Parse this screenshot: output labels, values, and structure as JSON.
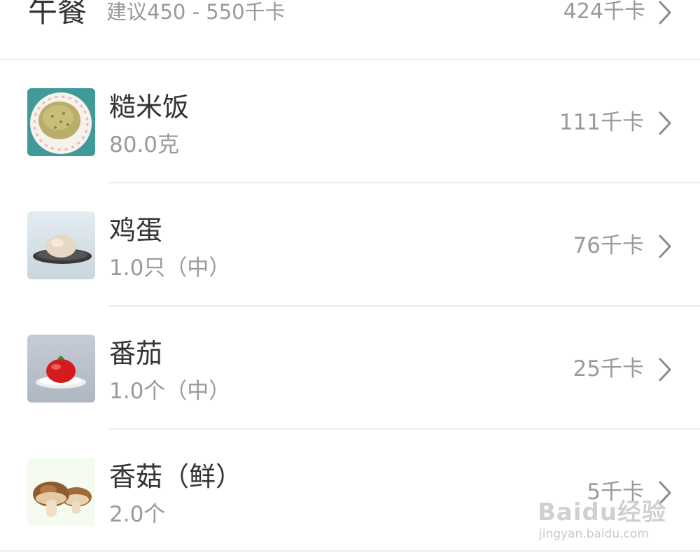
{
  "meal": {
    "title": "午餐",
    "suggestion": "建议450 - 550千卡",
    "total": "424千卡"
  },
  "foods": [
    {
      "name": "糙米饭",
      "amount": "80.0克",
      "kcal": "111千卡",
      "thumb_icon": "brown-rice-plate-icon"
    },
    {
      "name": "鸡蛋",
      "amount": "1.0只（中）",
      "kcal": "76千卡",
      "thumb_icon": "egg-on-plate-icon"
    },
    {
      "name": "番茄",
      "amount": "1.0个（中）",
      "kcal": "25千卡",
      "thumb_icon": "tomato-on-plate-icon"
    },
    {
      "name": "香菇（鲜）",
      "amount": "2.0个",
      "kcal": "5千卡",
      "thumb_icon": "shiitake-mushroom-icon"
    }
  ],
  "watermark": {
    "logo": "Baidu经验",
    "url": "jingyan.baidu.com"
  },
  "colors": {
    "primary_text": "#333333",
    "secondary_text": "#9a9a9a",
    "divider": "#ececec",
    "background": "#ffffff"
  }
}
